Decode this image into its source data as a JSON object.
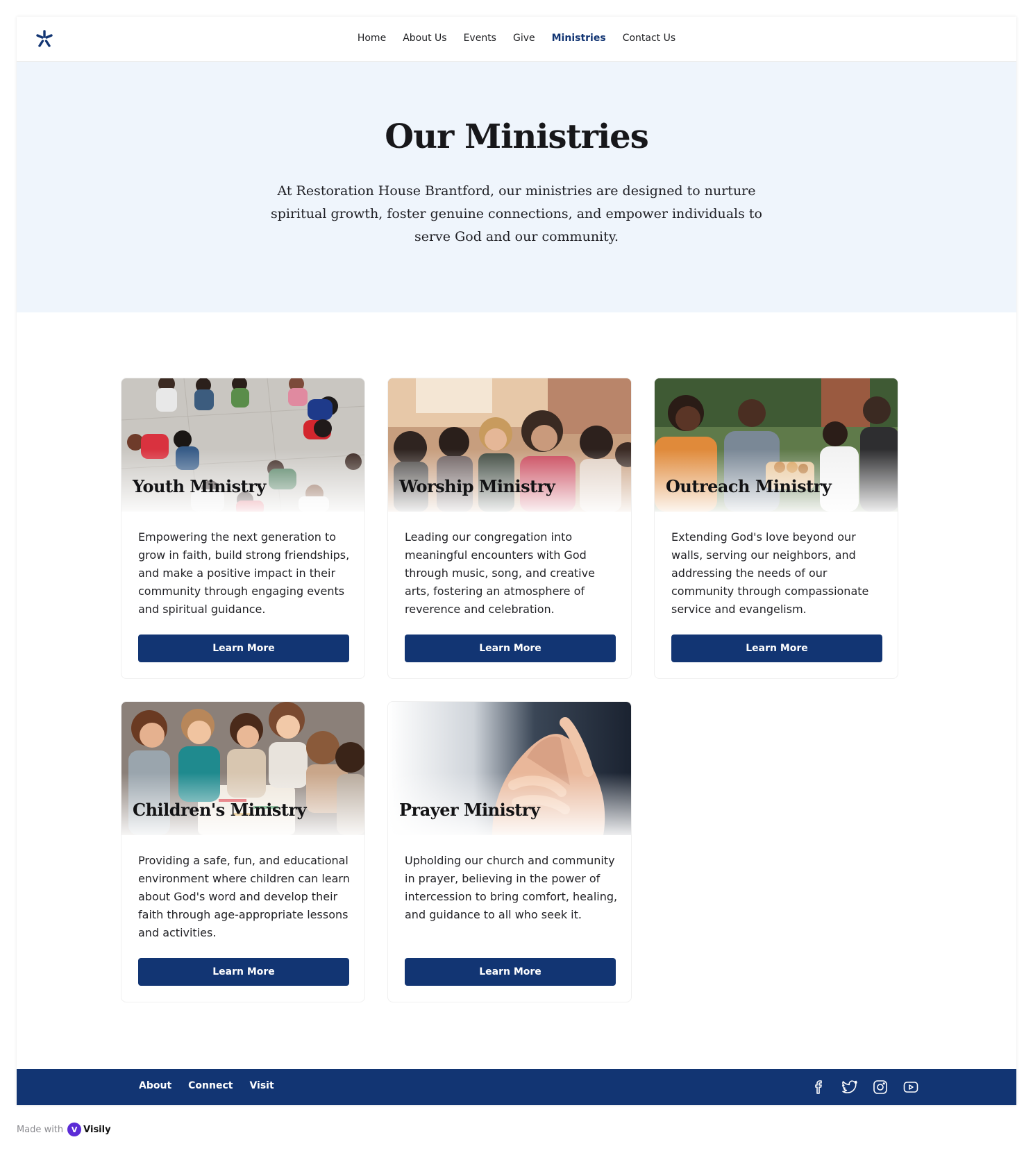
{
  "nav": {
    "logo_icon": "asterisk-logo-icon",
    "links": [
      "Home",
      "About Us",
      "Events",
      "Give",
      "Ministries",
      "Contact Us"
    ],
    "active": "Ministries"
  },
  "hero": {
    "title": "Our Ministries",
    "subtitle": "At Restoration House Brantford, our ministries are designed to nurture spiritual growth, foster genuine connections, and empower individuals to serve God and our community."
  },
  "cards": [
    {
      "title": "Youth Ministry",
      "description": "Empowering the next generation to grow in faith, build strong friendships, and make a positive impact in their community through engaging events and spiritual guidance.",
      "button": "Learn More"
    },
    {
      "title": "Worship Ministry",
      "description": "Leading our congregation into meaningful encounters with God through music, song, and creative arts, fostering an atmosphere of reverence and celebration.",
      "button": "Learn More"
    },
    {
      "title": "Outreach Ministry",
      "description": "Extending God's love beyond our walls, serving our neighbors, and addressing the needs of our community through compassionate service and evangelism.",
      "button": "Learn More"
    },
    {
      "title": "Children's Ministry",
      "description": "Providing a safe, fun, and educational environment where children can learn about God's word and develop their faith through age-appropriate lessons and activities.",
      "button": "Learn More"
    },
    {
      "title": "Prayer Ministry",
      "description": "Upholding our church and community in prayer, believing in the power of intercession to bring comfort, healing, and guidance to all who seek it.",
      "button": "Learn More"
    }
  ],
  "footer": {
    "links": [
      "About",
      "Connect",
      "Visit"
    ],
    "social_icons": [
      "facebook-icon",
      "twitter-icon",
      "instagram-icon",
      "youtube-icon"
    ]
  },
  "made_with": {
    "prefix": "Made with",
    "brand": "Visily"
  },
  "colors": {
    "primary": "#123573",
    "hero_bg": "#eff5fc"
  }
}
